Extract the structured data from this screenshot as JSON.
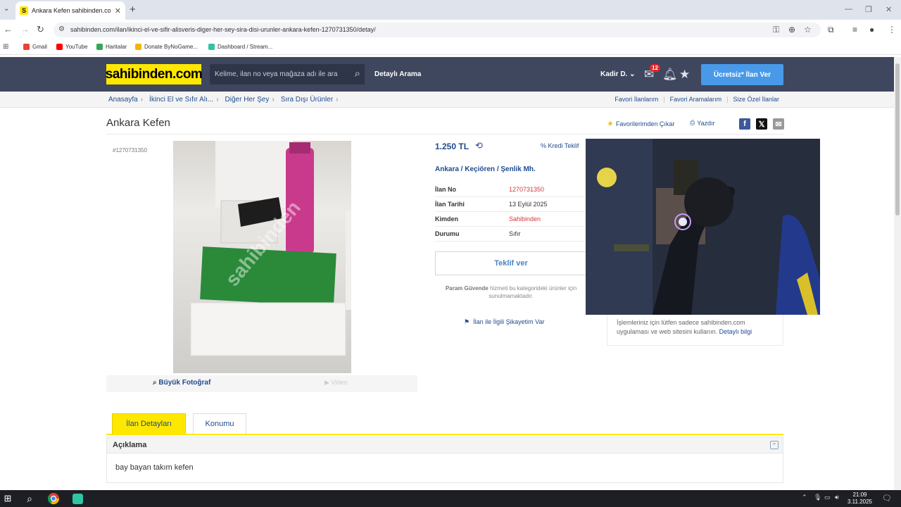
{
  "browser": {
    "tab_title": "Ankara Kefen sahibinden.comda",
    "url": "sahibinden.com/ilan/ikinci-el-ve-sifir-alisveris-diger-her-sey-sira-disi-urunler-ankara-kefen-1270731350/detay/",
    "bookmarks": [
      "Gmail",
      "YouTube",
      "Haritalar",
      "Donate ByNoGame...",
      "Dashboard / Stream..."
    ]
  },
  "header": {
    "logo": "sahibinden.com",
    "search_placeholder": "Kelime, ilan no veya mağaza adı ile ara",
    "advanced_search": "Detaylı Arama",
    "user": "Kadir D.",
    "message_count": "12",
    "post_button": "Ücretsiz* İlan Ver"
  },
  "breadcrumb": [
    "Anasayfa",
    "İkinci El ve Sıfır Alı...",
    "Diğer Her Şey",
    "Sıra Dışı Ürünler"
  ],
  "top_links": [
    "Favori İlanlarım",
    "Favori Aramalarım",
    "Size Özel İlanlar"
  ],
  "listing": {
    "title": "Ankara Kefen",
    "id_label": "#1270731350",
    "fav_remove": "Favorilerimden Çıkar",
    "print": "Yazdır",
    "photo_watermark": "sahibinden",
    "big_photo": "Büyük Fotoğraf",
    "video": "Video",
    "price": "1.250 TL",
    "credit_offer": "Kredi Teklif",
    "location": "Ankara  /  Keçiören  /  Şenlik Mh.",
    "details": [
      {
        "key": "İlan No",
        "value": "1270731350"
      },
      {
        "key": "İlan Tarihi",
        "value": "13 Eylül 2025"
      },
      {
        "key": "Kimden",
        "value": "Sahibinden"
      },
      {
        "key": "Durumu",
        "value": "Sıfır"
      }
    ],
    "offer_button": "Teklif ver",
    "escrow_bold": "Param Güvende",
    "escrow_text": " hizmeti bu kategorideki ürünler için sunulmamaktadır.",
    "complaint": "İlan ile İlgili Şikayetim Var",
    "safety_text": "İşlemleriniz için lütfen sadece sahibinden.com uygulaması ve web sitesini kullanın. ",
    "safety_link": "Detaylı bilgi"
  },
  "tabs": {
    "details": "İlan Detayları",
    "location": "Konumu"
  },
  "description": {
    "heading": "Açıklama",
    "text": "bay bayan takım kefen"
  },
  "taskbar": {
    "time": "21:09",
    "date": "3.11.2025"
  },
  "colors": {
    "brand_yellow": "#ffe800",
    "header_bg": "#3f475f",
    "link_blue": "#1f4b8e",
    "post_button": "#489ae9",
    "accent_red": "#d9353b"
  }
}
